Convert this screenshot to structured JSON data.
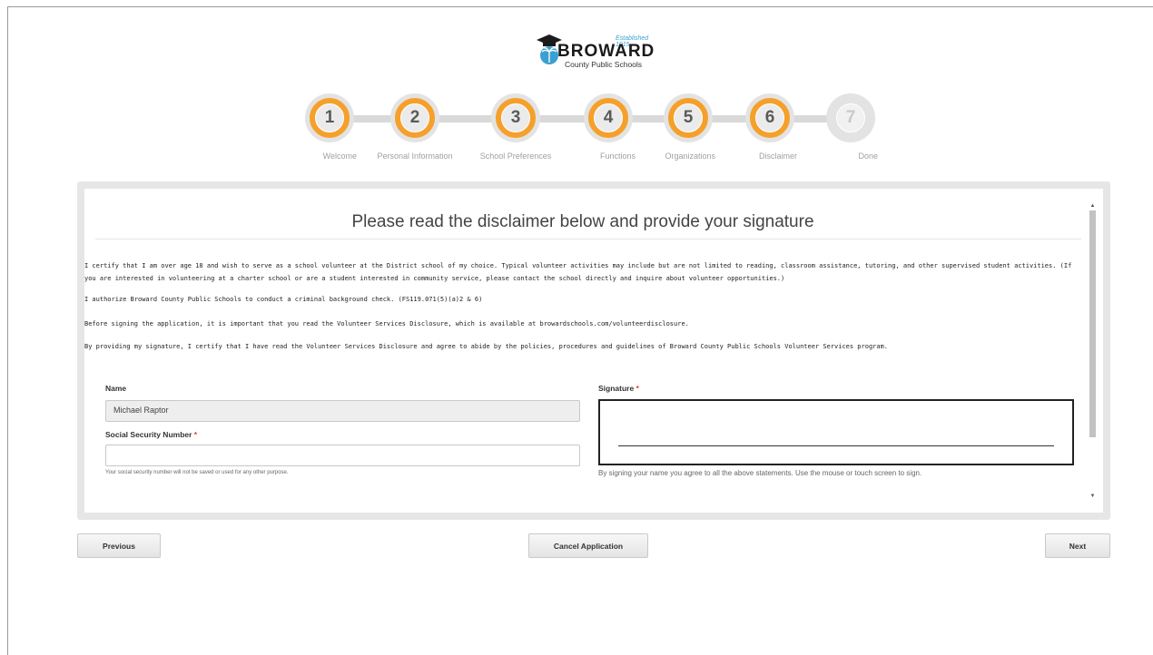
{
  "logo": {
    "established": "Established 1915",
    "name": "BROWARD",
    "subtitle": "County Public Schools"
  },
  "steps": [
    {
      "number": "1",
      "label": "Welcome",
      "state": "complete"
    },
    {
      "number": "2",
      "label": "Personal Information",
      "state": "complete"
    },
    {
      "number": "3",
      "label": "School Preferences",
      "state": "complete"
    },
    {
      "number": "4",
      "label": "Functions",
      "state": "complete"
    },
    {
      "number": "5",
      "label": "Organizations",
      "state": "complete"
    },
    {
      "number": "6",
      "label": "Disclaimer",
      "state": "current"
    },
    {
      "number": "7",
      "label": "Done",
      "state": "pending"
    }
  ],
  "colors": {
    "accent": "#f5a02b",
    "required": "#e23b3b"
  },
  "disclaimer": {
    "heading": "Please read the disclaimer below and provide your signature",
    "paragraphs": [
      "I certify that I am over age 18 and wish to serve as a school volunteer at the District school of my choice. Typical volunteer activities may include but are not limited to reading, classroom assistance, tutoring, and other supervised student activities. (If you are interested in volunteering at a charter school or are a student interested in community service, please contact the school directly and inquire about volunteer opportunities.)",
      "I authorize Broward County Public Schools to conduct a criminal background check. (FS119.071(5)(a)2 & 6)",
      "Before signing the application, it is important that you read the Volunteer Services Disclosure, which is available at browardschools.com/volunteerdisclosure.",
      "By providing my signature, I certify that I have read the Volunteer Services Disclosure and agree to abide by the policies, procedures and guidelines of Broward County Public Schools Volunteer Services program."
    ]
  },
  "form": {
    "name_label": "Name",
    "name_value": "Michael Raptor",
    "ssn_label": "Social Security Number",
    "ssn_value": "",
    "ssn_hint": "Your social security number will not be saved or used for any other purpose.",
    "signature_label": "Signature",
    "signature_hint": "By signing your name you agree to all the above statements. Use the mouse or touch screen to sign.",
    "required_mark": "*"
  },
  "buttons": {
    "previous": "Previous",
    "cancel": "Cancel Application",
    "next": "Next"
  }
}
